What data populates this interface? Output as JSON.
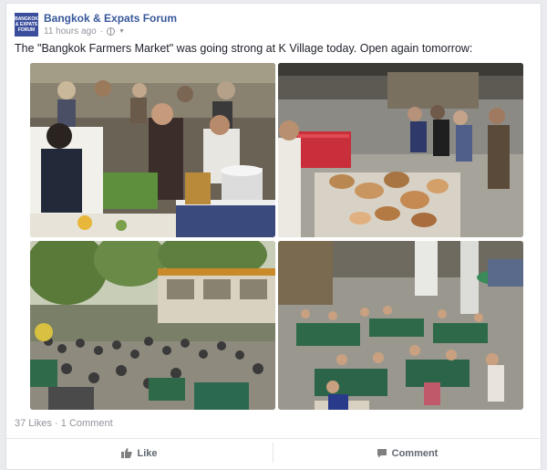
{
  "post": {
    "page_name": "Bangkok & Expats Forum",
    "avatar_text": "BANGKOK & EXPATS FORUM",
    "timestamp": "11 hours ago",
    "visibility_icon": "globe-icon",
    "chevron_icon": "chevron-down-icon",
    "text": "The \"Bangkok Farmers Market\" was going strong at K Village today. Open again tomorrow:",
    "photos": [
      "market-photo-vendor-stall",
      "market-photo-bread-table",
      "market-photo-outdoor-plaza",
      "market-photo-aerial-view"
    ]
  },
  "engagement": {
    "likes_text": "37 Likes",
    "separator": "·",
    "comments_text": "1 Comment"
  },
  "actions": {
    "like_label": "Like",
    "like_icon": "thumbs-up-icon",
    "comment_label": "Comment",
    "comment_icon": "speech-bubble-icon"
  },
  "colors": {
    "link": "#365899",
    "meta": "#90949c",
    "avatar": "#3b4e9c"
  }
}
